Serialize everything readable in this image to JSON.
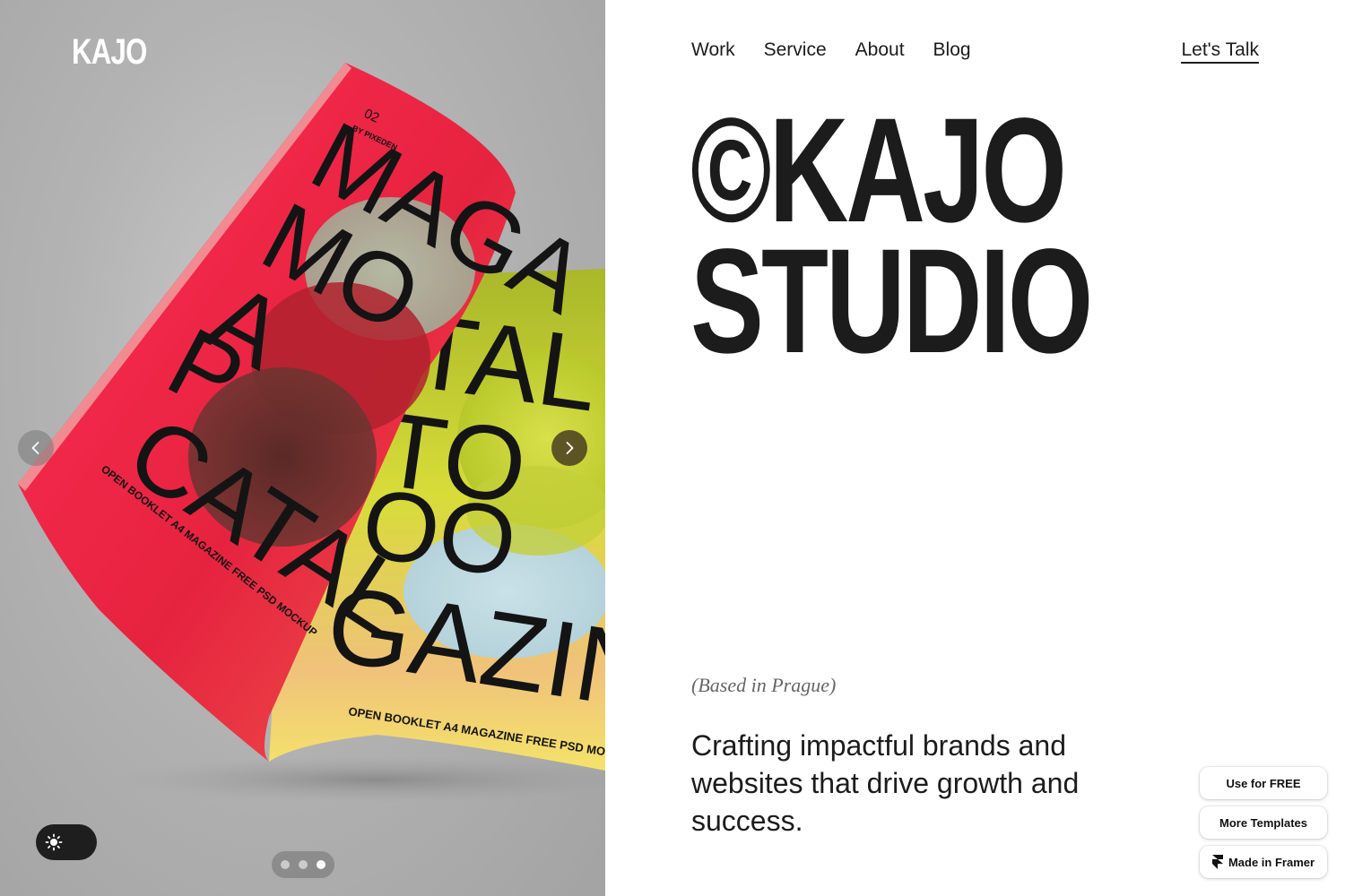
{
  "hero": {
    "logo": "KAJO",
    "mockup_text": {
      "issue": "02",
      "byline": "BY PIXEDEN",
      "cover_words": [
        "MAGA",
        "MO",
        "A",
        "P",
        "CATAL"
      ],
      "inner_words": [
        "TAL",
        "TO",
        "OO",
        "ALOG",
        "GAZIN"
      ],
      "booklet_line_left": "OPEN BOOKLET A4 MAGAZINE FREE PSD MOCKUP",
      "booklet_line_right": "OPEN BOOKLET A4 MAGAZINE FREE PSD MOCKUP"
    },
    "slides": {
      "count": 3,
      "active_index": 3
    },
    "prev_icon": "chevron-left-icon",
    "next_icon": "chevron-right-icon",
    "theme_icon": "sun-icon"
  },
  "nav": {
    "items": [
      {
        "label": "Work"
      },
      {
        "label": "Service"
      },
      {
        "label": "About"
      },
      {
        "label": "Blog"
      }
    ],
    "cta": "Let's Talk"
  },
  "main": {
    "title_line1": "©KAJO",
    "title_line2": "STUDIO",
    "location": "(Based in Prague)",
    "tagline": "Crafting impactful brands and websites that drive growth and success."
  },
  "badges": {
    "use_free": "Use for FREE",
    "more_templates": "More Templates",
    "made_in_framer": "Made in Framer",
    "framer_icon": "framer-logo-icon"
  },
  "colors": {
    "accent_dark": "#1c1c1c",
    "magazine_red": "#e01e3c",
    "magazine_yellow": "#d4d832"
  }
}
